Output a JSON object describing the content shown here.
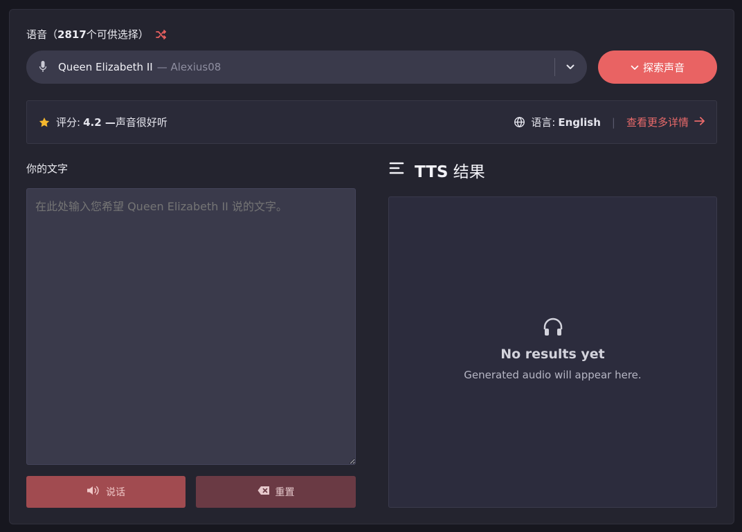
{
  "header": {
    "label_prefix": "语音（",
    "count": "2817",
    "label_suffix": " 个可供选择）",
    "shuffle_icon": "shuffle-icon"
  },
  "voice": {
    "name": "Queen Elizabeth II",
    "author": "— Alexius08",
    "mic_icon": "mic-icon",
    "chevron_icon": "chevron-down-icon"
  },
  "explore_button": {
    "label": "探索声音",
    "icon": "chevron-down-icon"
  },
  "info": {
    "rating_label": "评分:",
    "rating_value": "4.2 —",
    "rating_text": " 声音很好听",
    "language_label": "语言:",
    "language_value": "English",
    "separator": "|",
    "more_link": "查看更多详情",
    "arrow_icon": "arrow-right-icon"
  },
  "input": {
    "label": "你的文字",
    "placeholder": "在此处输入您希望 Queen Elizabeth II 说的文字。",
    "value": ""
  },
  "buttons": {
    "speak": "说话",
    "reset": "重置"
  },
  "results": {
    "title_bold": "TTS",
    "title_rest": " 结果",
    "empty_title": "No results yet",
    "empty_subtitle": "Generated audio will appear here."
  },
  "colors": {
    "accent": "#e96363",
    "panel": "#24242f",
    "input_bg": "#3a3a4b"
  }
}
